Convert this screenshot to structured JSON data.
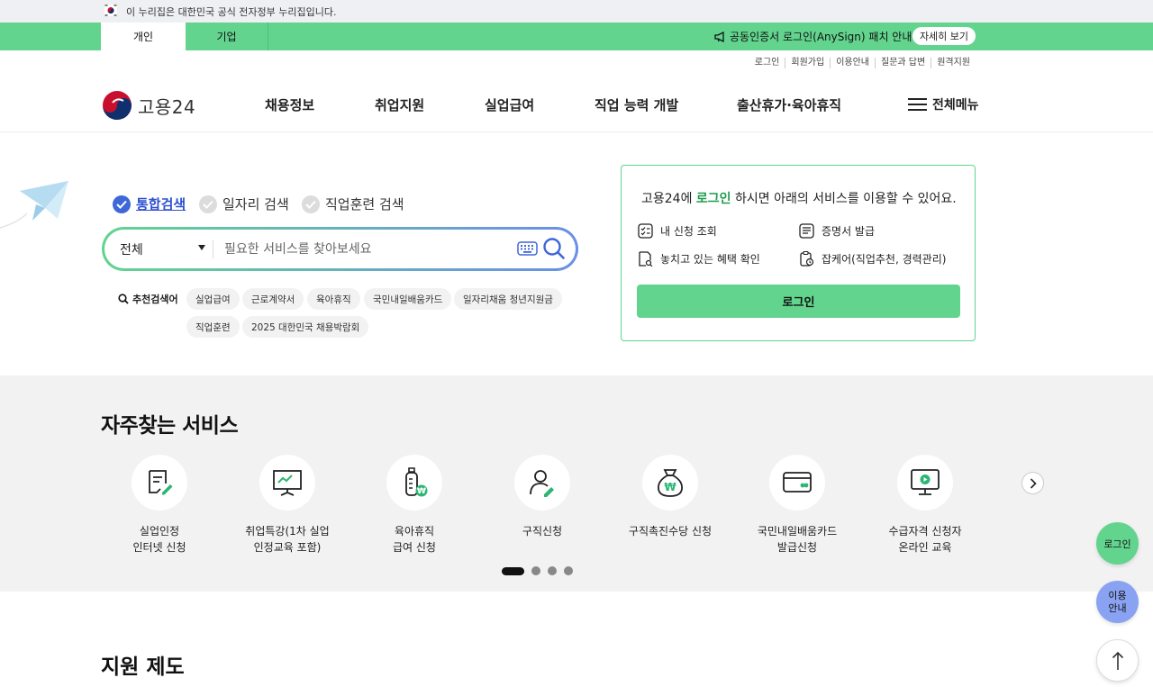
{
  "gov_banner": {
    "text": "이 누리집은 대한민국 공식 전자정부 누리집입니다."
  },
  "top_tabs": [
    {
      "label": "개인",
      "active": true
    },
    {
      "label": "기업",
      "active": false
    }
  ],
  "notice": {
    "icon": "megaphone-icon",
    "text": "공동인증서 로그인(AnySign) 패치 안내",
    "button": "자세히 보기"
  },
  "utility_links": [
    "로그인",
    "회원가입",
    "이용안내",
    "질문과 답변",
    "원격지원"
  ],
  "logo": {
    "name": "고용24"
  },
  "nav": [
    "채용정보",
    "취업지원",
    "실업급여",
    "직업 능력 개발",
    "출산휴가·육아휴직"
  ],
  "all_menu": {
    "icon": "hamburger-icon",
    "label": "전체메뉴"
  },
  "search": {
    "types": [
      {
        "label": "통합검색",
        "active": true
      },
      {
        "label": "일자리 검색",
        "active": false
      },
      {
        "label": "직업훈련 검색",
        "active": false
      }
    ],
    "category": "전체",
    "placeholder": "필요한 서비스를 찾아보세요",
    "recommend_label": "추천검색어",
    "recommend": [
      "실업급여",
      "근로계약서",
      "육아휴직",
      "국민내일배움카드",
      "일자리채움 청년지원금",
      "직업훈련",
      "2025 대한민국 채용박람회"
    ]
  },
  "login_card": {
    "title_pre": "고용24에 ",
    "title_hl": "로그인",
    "title_post": " 하시면 아래의 서비스를 이용할 수 있어요.",
    "items": [
      "내 신청 조회",
      "증명서 발급",
      "놓치고 있는 혜택 확인",
      "잡케어(직업추천, 경력관리)"
    ],
    "button": "로그인"
  },
  "frequent": {
    "title": "자주찾는 서비스",
    "items": [
      {
        "line1": "실업인정",
        "line2": "인터넷 신청",
        "icon": "document-pen-icon"
      },
      {
        "line1": "취업특강(1차 실업",
        "line2": "인정교육 포함)",
        "icon": "presentation-board-icon"
      },
      {
        "line1": "육아휴직",
        "line2": "급여 신청",
        "icon": "baby-bottle-won-icon"
      },
      {
        "line1": "구직신청",
        "line2": "",
        "icon": "person-pen-icon"
      },
      {
        "line1": "구직촉진수당 신청",
        "line2": "",
        "icon": "money-bag-won-icon"
      },
      {
        "line1": "국민내일배움카드",
        "line2": "발급신청",
        "icon": "card-icon"
      },
      {
        "line1": "수급자격 신청자",
        "line2": "온라인 교육",
        "icon": "monitor-play-icon"
      }
    ],
    "pages": 4,
    "current_page": 1
  },
  "support": {
    "title": "지원 제도"
  },
  "floating": {
    "login": "로그인",
    "guide_line1": "이용",
    "guide_line2": "안내",
    "top_icon": "arrow-up-icon"
  },
  "colors": {
    "green": "#62d48e",
    "blue": "#3f67d8",
    "lavender": "#8aa2f2"
  }
}
